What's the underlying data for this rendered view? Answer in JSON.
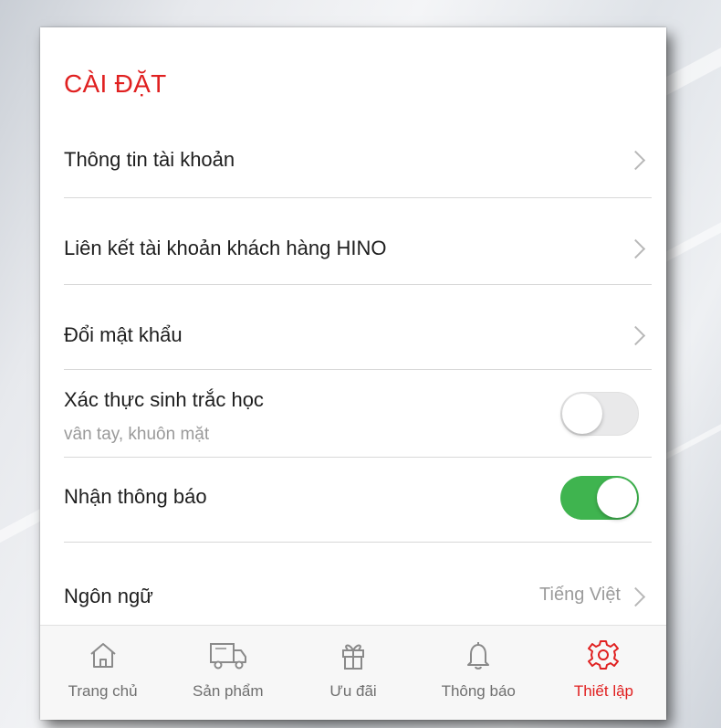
{
  "settings": {
    "title": "CÀI ĐẶT",
    "items": [
      {
        "label": "Thông tin tài khoản"
      },
      {
        "label": "Liên kết tài khoản khách hàng HINO"
      },
      {
        "label": "Đổi mật khẩu"
      },
      {
        "label": "Xác thực sinh trắc học",
        "sublabel": "vân tay, khuôn mặt",
        "toggle": "off"
      },
      {
        "label": "Nhận thông báo",
        "toggle": "on"
      },
      {
        "label": "Ngôn ngữ",
        "value": "Tiếng Việt"
      }
    ]
  },
  "tabbar": {
    "active": "Thiết lập",
    "items": [
      {
        "label": "Trang chủ",
        "icon": "home-icon"
      },
      {
        "label": "Sản phẩm",
        "icon": "truck-icon"
      },
      {
        "label": "Ưu đãi",
        "icon": "gift-icon"
      },
      {
        "label": "Thông báo",
        "icon": "bell-icon"
      },
      {
        "label": "Thiết lập",
        "icon": "gear-icon"
      }
    ]
  },
  "colors": {
    "accent": "#e02020",
    "toggle_on": "#3fb44f",
    "icon_inactive": "#8a8a8a"
  }
}
